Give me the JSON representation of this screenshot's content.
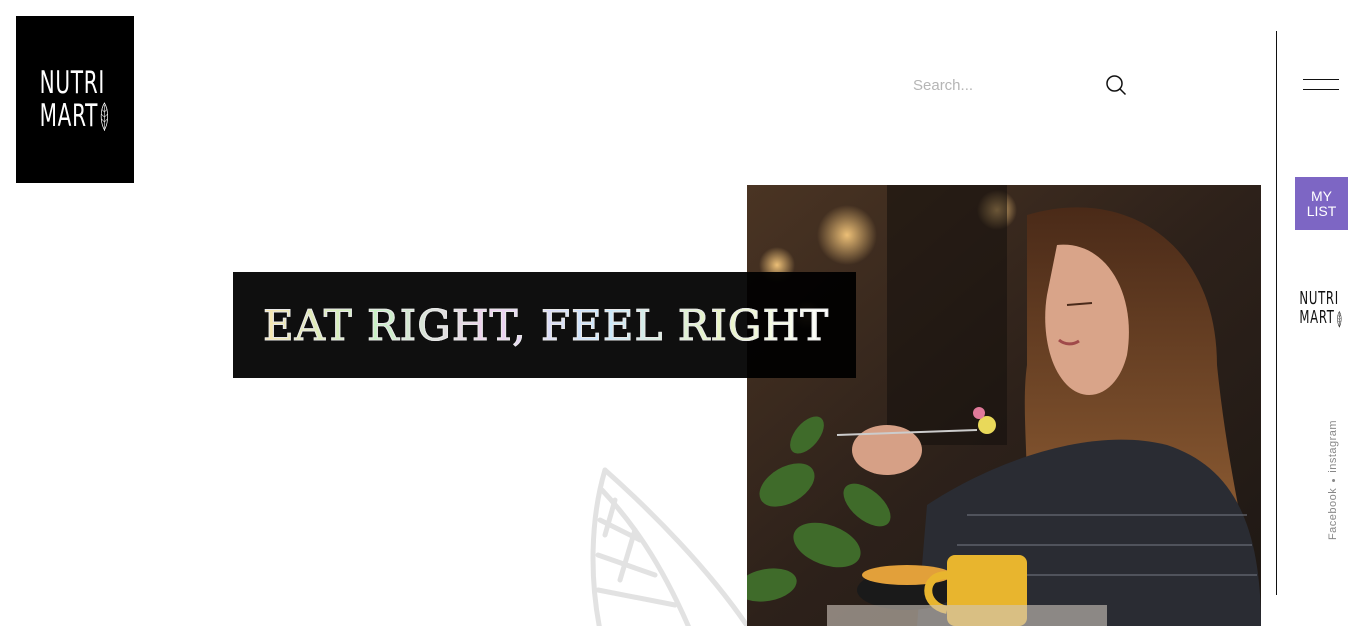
{
  "brand": {
    "line1": "NUTRI",
    "line2": "MART"
  },
  "search": {
    "placeholder": "Search..."
  },
  "sidebar": {
    "mylist_label": "MY LIST",
    "social": {
      "facebook": "Facebook",
      "instagram": "instagram"
    },
    "accent_color": "#7d66c4"
  },
  "hero": {
    "tagline": "EAT RIGHT, FEEL RIGHT"
  },
  "icons": {
    "search": "search-icon",
    "menu": "hamburger-menu-icon",
    "leaf": "leaf-icon"
  }
}
